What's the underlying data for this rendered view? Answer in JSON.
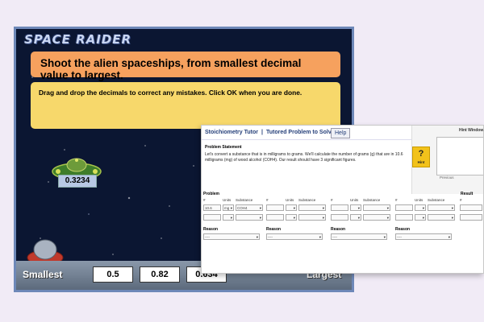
{
  "game": {
    "title": "SPACE RAIDER",
    "instruction_primary": "Shoot the alien spaceships, from smallest decimal value to largest.",
    "instruction_secondary": "Drag and drop the decimals to correct any mistakes. Click OK when you are done.",
    "alien_value": "0.3234",
    "label_smallest": "Smallest",
    "label_largest": "Largest",
    "slots": [
      "0.5",
      "0.82",
      "0.634"
    ]
  },
  "tutor": {
    "title": "Stoichiometry Tutor",
    "subtitle": "Tutored Problem to Solve",
    "separator": "|",
    "help_label": "Help",
    "hint_window_title": "Hint Window",
    "hint_button_label": "Hint",
    "hint_prev_label": "Previous",
    "problem_statement_label": "Problem Statement",
    "problem_text": "Let's convert a substance that is in milligrams to grams. We'll calculate the number of grams (g) that are in 10.6 milligrams (mg) of wood alcohol (COH4). Our result should have 3 significant figures.",
    "problem_label": "Problem",
    "result_label": "Result",
    "reason_label": "Reason",
    "col_hash": "#",
    "col_units": "Units",
    "col_substance": "Substance",
    "given_value": "10.6",
    "given_units": "mg",
    "given_substance": "COH4",
    "dash": "----"
  },
  "colors": {
    "game_bg": "#0b1632",
    "instruction_primary_bg": "#f6a15e",
    "instruction_secondary_bg": "#f7d86b",
    "hint_button": "#f2c21b",
    "page_bg": "#f1ebf6"
  }
}
